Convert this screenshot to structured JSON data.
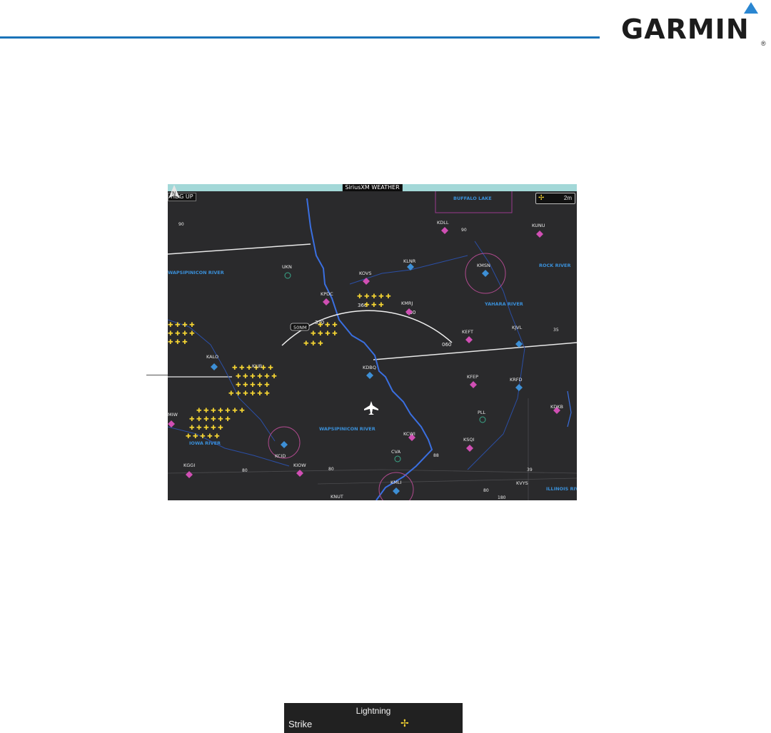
{
  "brand": {
    "logo_text": "GARMIN",
    "registered": "®",
    "accent": "#1a73b8"
  },
  "map": {
    "title": "SiriusXM WEATHER",
    "orientation": "HDG UP",
    "age_value": "2m",
    "range_label": "50NM",
    "arc_headings": [
      "330",
      "360",
      "030",
      "060"
    ],
    "airports": [
      "KALO",
      "KCID",
      "KIOW",
      "KGGI",
      "KDBQ",
      "KPDC",
      "KOVS",
      "KLNR",
      "KMSN",
      "KEFT",
      "KJVL",
      "KRFD",
      "KFEP",
      "KCWI",
      "KSQI",
      "KMLI",
      "KVYS",
      "KDKB",
      "KDLL",
      "KUNU",
      "KNUT",
      "UKN",
      "CVA",
      "PLL",
      "KMRJ",
      "KLIB",
      "MIW"
    ],
    "rivers": [
      "WAPSIPINICON RIVER",
      "IOWA RIVER",
      "ROCK RIVER",
      "YAHARA RIVER",
      "ILLINOIS RIVE",
      "BUFFALO LAKE"
    ],
    "roads": [
      "90",
      "90",
      "80",
      "80",
      "88",
      "39",
      "80",
      "180",
      "35",
      "90"
    ],
    "colors": {
      "lightning": "#f2d232",
      "river": "#3a6fe0",
      "airport_towered": "#3d8fd6",
      "airport_untowered": "#d04fb4",
      "background": "#2a2a2c"
    }
  },
  "legend": {
    "title": "Lightning",
    "label": "Strike",
    "icon": "lightning-strike-icon"
  }
}
